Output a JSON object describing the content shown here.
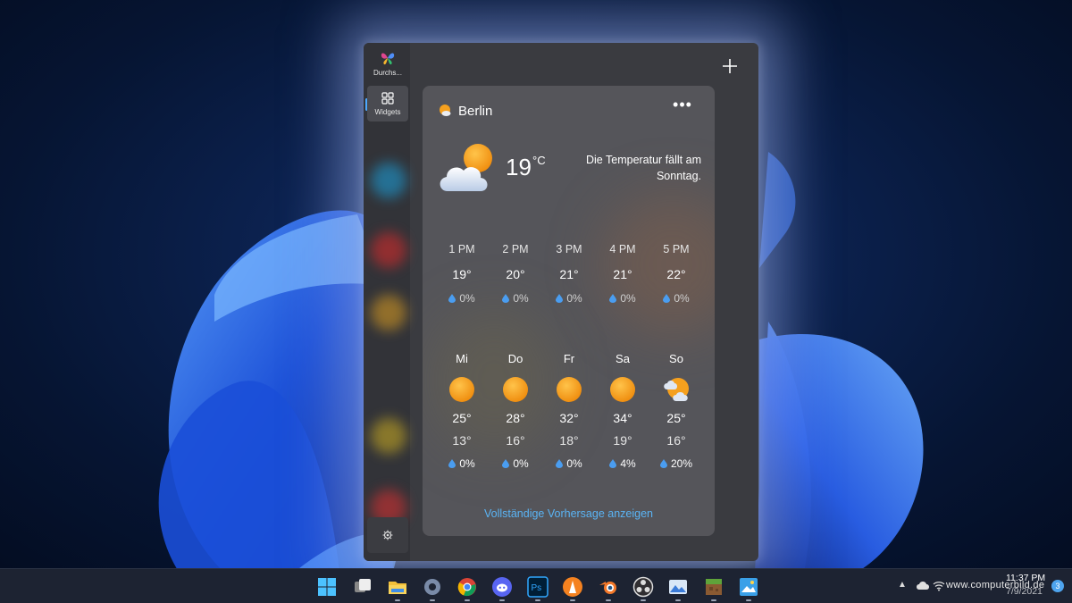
{
  "sidebar": {
    "items": [
      {
        "label": "Durchs...",
        "icon": "butterfly-icon"
      },
      {
        "label": "Widgets",
        "icon": "widgets-icon"
      }
    ],
    "settings_icon": "gear-icon"
  },
  "header": {
    "add_icon": "plus-icon"
  },
  "weather": {
    "city": "Berlin",
    "more_label": "•••",
    "current_temp": "19",
    "unit": "°C",
    "summary": "Die Temperatur fällt am Sonntag.",
    "hourly": [
      {
        "time": "1 PM",
        "temp": "19°",
        "precip": "0%"
      },
      {
        "time": "2 PM",
        "temp": "20°",
        "precip": "0%"
      },
      {
        "time": "3 PM",
        "temp": "21°",
        "precip": "0%"
      },
      {
        "time": "4 PM",
        "temp": "21°",
        "precip": "0%"
      },
      {
        "time": "5 PM",
        "temp": "22°",
        "precip": "0%"
      }
    ],
    "daily": [
      {
        "day": "Mi",
        "icon": "sun-icon",
        "high": "25°",
        "low": "13°",
        "precip": "0%"
      },
      {
        "day": "Do",
        "icon": "sun-icon",
        "high": "28°",
        "low": "16°",
        "precip": "0%"
      },
      {
        "day": "Fr",
        "icon": "sun-icon",
        "high": "32°",
        "low": "18°",
        "precip": "0%"
      },
      {
        "day": "Sa",
        "icon": "sun-icon",
        "high": "34°",
        "low": "19°",
        "precip": "4%"
      },
      {
        "day": "So",
        "icon": "partly-cloudy-icon",
        "high": "25°",
        "low": "16°",
        "precip": "20%"
      }
    ],
    "full_forecast_link": "Vollständige Vorhersage anzeigen"
  },
  "taskbar": {
    "apps": [
      "start-icon",
      "task-view-icon",
      "file-explorer-icon",
      "settings-icon",
      "chrome-icon",
      "discord-icon",
      "photoshop-icon",
      "vlc-icon",
      "blender-icon",
      "obs-icon",
      "photos-icon",
      "minecraft-icon",
      "paint-icon"
    ],
    "tray_text": "www.computerbild.de",
    "clock_time": "11:37 PM",
    "clock_date": "7/9/2021",
    "notification_count": "3"
  },
  "colors": {
    "accent": "#4ca8ff",
    "link": "#5ab4f5",
    "sun": "#f5a01e",
    "drop": "#4a9df0"
  }
}
